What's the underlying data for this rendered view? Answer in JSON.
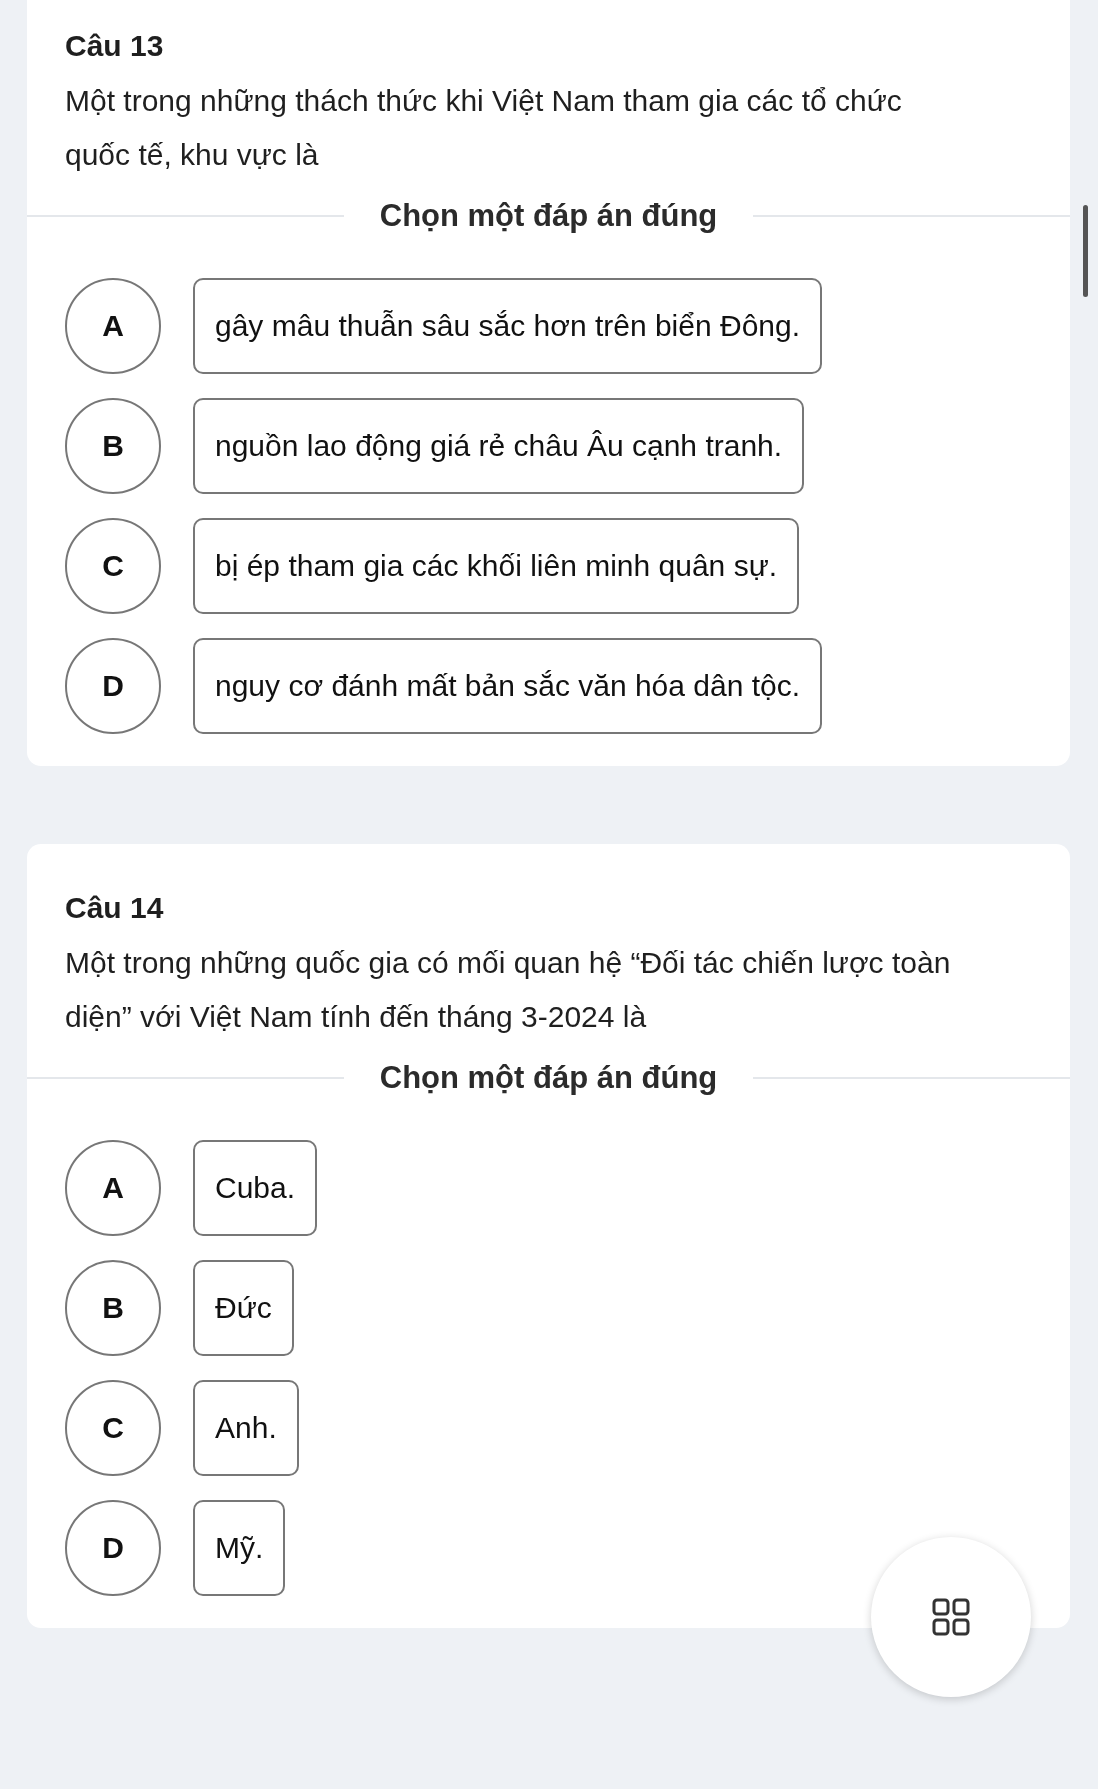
{
  "questions": [
    {
      "title": "Câu 13",
      "text": "Một trong những thách thức khi Việt Nam tham gia các tổ chức quốc tế, khu vực là",
      "instruction": "Chọn một đáp án đúng",
      "options": [
        {
          "letter": "A",
          "text": "gây mâu thuẫn sâu sắc hơn trên biển Đông.",
          "selected": false
        },
        {
          "letter": "B",
          "text": "nguồn lao động giá rẻ châu Âu cạnh tranh.",
          "selected": false
        },
        {
          "letter": "C",
          "text": "bị ép tham gia các khối liên minh quân sự.",
          "selected": false
        },
        {
          "letter": "D",
          "text": "nguy cơ đánh mất bản sắc văn hóa dân tộc.",
          "selected": false
        }
      ]
    },
    {
      "title": "Câu 14",
      "text": "Một trong những quốc gia có mối quan hệ “Đối tác chiến lược toàn diện” với Việt Nam tính đến tháng 3-2024 là",
      "instruction": "Chọn một đáp án đúng",
      "options": [
        {
          "letter": "A",
          "text": "Cuba.",
          "selected": false
        },
        {
          "letter": "B",
          "text": "Đức",
          "selected": false
        },
        {
          "letter": "C",
          "text": "Anh.",
          "selected": false
        },
        {
          "letter": "D",
          "text": "Mỹ.",
          "selected": false
        }
      ]
    }
  ]
}
